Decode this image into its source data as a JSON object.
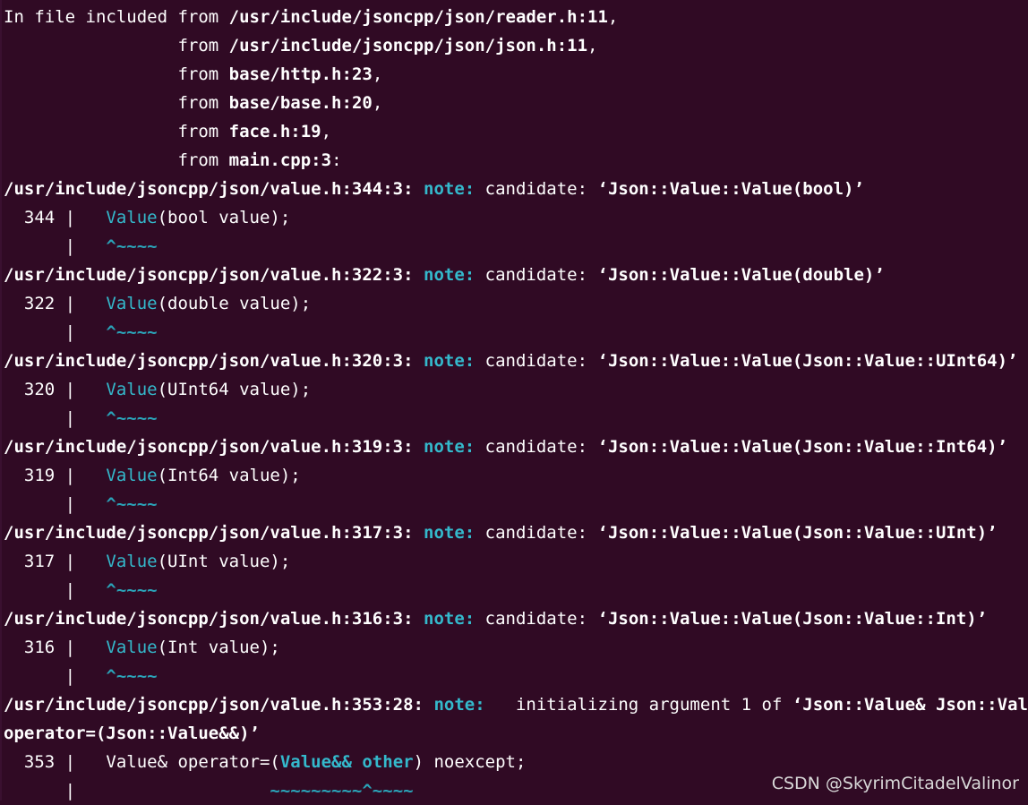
{
  "colors": {
    "background": "#300a24",
    "text": "#ffffff",
    "note": "#34b9cc",
    "caret": "#2aa3b8"
  },
  "includes": [
    {
      "prefix": "In file included from ",
      "file": "/usr/include/jsoncpp/json/reader.h:11",
      "suffix": ","
    },
    {
      "prefix": "                 from ",
      "file": "/usr/include/jsoncpp/json/json.h:11",
      "suffix": ","
    },
    {
      "prefix": "                 from ",
      "file": "base/http.h:23",
      "suffix": ","
    },
    {
      "prefix": "                 from ",
      "file": "base/base.h:20",
      "suffix": ","
    },
    {
      "prefix": "                 from ",
      "file": "face.h:19",
      "suffix": ","
    },
    {
      "prefix": "                 from ",
      "file": "main.cpp:3",
      "suffix": ":"
    }
  ],
  "candidates": [
    {
      "loc": "/usr/include/jsoncpp/json/value.h:344:3:",
      "note": "note:",
      "text": " candidate: ",
      "sig": "‘Json::Value::Value(bool)’",
      "gutter": "  344 |   ",
      "func": "Value",
      "rest": "(bool value);",
      "gutter2": "      |   ",
      "caret": "^~~~~"
    },
    {
      "loc": "/usr/include/jsoncpp/json/value.h:322:3:",
      "note": "note:",
      "text": " candidate: ",
      "sig": "‘Json::Value::Value(double)’",
      "gutter": "  322 |   ",
      "func": "Value",
      "rest": "(double value);",
      "gutter2": "      |   ",
      "caret": "^~~~~"
    },
    {
      "loc": "/usr/include/jsoncpp/json/value.h:320:3:",
      "note": "note:",
      "text": " candidate: ",
      "sig": "‘Json::Value::Value(Json::Value::UInt64)’",
      "gutter": "  320 |   ",
      "func": "Value",
      "rest": "(UInt64 value);",
      "gutter2": "      |   ",
      "caret": "^~~~~"
    },
    {
      "loc": "/usr/include/jsoncpp/json/value.h:319:3:",
      "note": "note:",
      "text": " candidate: ",
      "sig": "‘Json::Value::Value(Json::Value::Int64)’",
      "gutter": "  319 |   ",
      "func": "Value",
      "rest": "(Int64 value);",
      "gutter2": "      |   ",
      "caret": "^~~~~"
    },
    {
      "loc": "/usr/include/jsoncpp/json/value.h:317:3:",
      "note": "note:",
      "text": " candidate: ",
      "sig": "‘Json::Value::Value(Json::Value::UInt)’",
      "gutter": "  317 |   ",
      "func": "Value",
      "rest": "(UInt value);",
      "gutter2": "      |   ",
      "caret": "^~~~~"
    },
    {
      "loc": "/usr/include/jsoncpp/json/value.h:316:3:",
      "note": "note:",
      "text": " candidate: ",
      "sig": "‘Json::Value::Value(Json::Value::Int)’",
      "gutter": "  316 |   ",
      "func": "Value",
      "rest": "(Int value);",
      "gutter2": "      |   ",
      "caret": "^~~~~"
    }
  ],
  "final": {
    "loc": "/usr/include/jsoncpp/json/value.h:353:28:",
    "note": "note:",
    "text": "   initializing argument 1 of ",
    "sig1": "‘Json::Value& Json::Value::",
    "sig2": "operator=(Json::Value&&)’",
    "gutter": "  353 |   ",
    "code_a": "Value& operator=(",
    "code_hl": "Value&& other",
    "code_b": ") noexcept;",
    "gutter2": "      |                   ",
    "caret": "~~~~~~~~~^~~~~"
  },
  "watermark": "CSDN @SkyrimCitadelValinor"
}
